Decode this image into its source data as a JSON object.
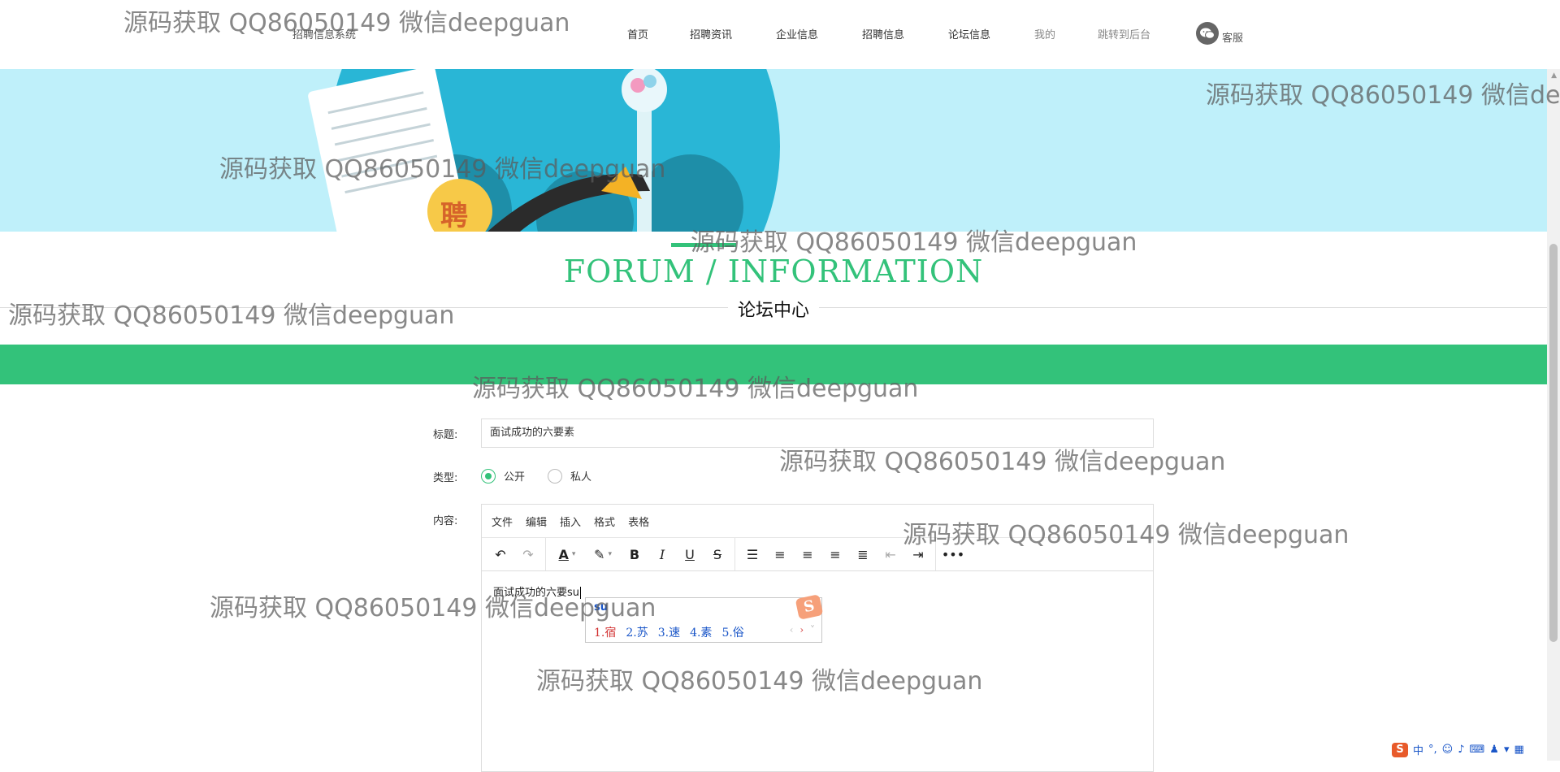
{
  "header": {
    "site_title": "招聘信息系统",
    "nav": [
      {
        "label": "首页"
      },
      {
        "label": "招聘资讯"
      },
      {
        "label": "企业信息"
      },
      {
        "label": "招聘信息"
      },
      {
        "label": "论坛信息"
      },
      {
        "label": "我的"
      },
      {
        "label": "跳转到后台"
      }
    ],
    "service_label": "客服"
  },
  "banner": {
    "badge_text": "聘",
    "colors": {
      "sky": "#bff0fa",
      "circle": "#29b6d6"
    }
  },
  "section": {
    "title_en": "FORUM / INFORMATION",
    "title_cn": "论坛中心",
    "accent_color": "#33c27a"
  },
  "form": {
    "title_label": "标题:",
    "title_value": "面试成功的六要素",
    "type_label": "类型:",
    "type_options": [
      {
        "label": "公开",
        "checked": true
      },
      {
        "label": "私人",
        "checked": false
      }
    ],
    "content_label": "内容:",
    "editor": {
      "menus": [
        "文件",
        "编辑",
        "插入",
        "格式",
        "表格"
      ],
      "content_text": "面试成功的六要su"
    }
  },
  "ime": {
    "composition": "su",
    "candidates": [
      "1.宿",
      "2.苏",
      "3.速",
      "4.素",
      "5.俗"
    ],
    "logo": "S"
  },
  "tray": {
    "logo": "S",
    "mode": "中"
  },
  "watermarks": [
    "源码获取 QQ86050149 微信deepguan",
    "源码获取 QQ86050149 微信dee"
  ]
}
